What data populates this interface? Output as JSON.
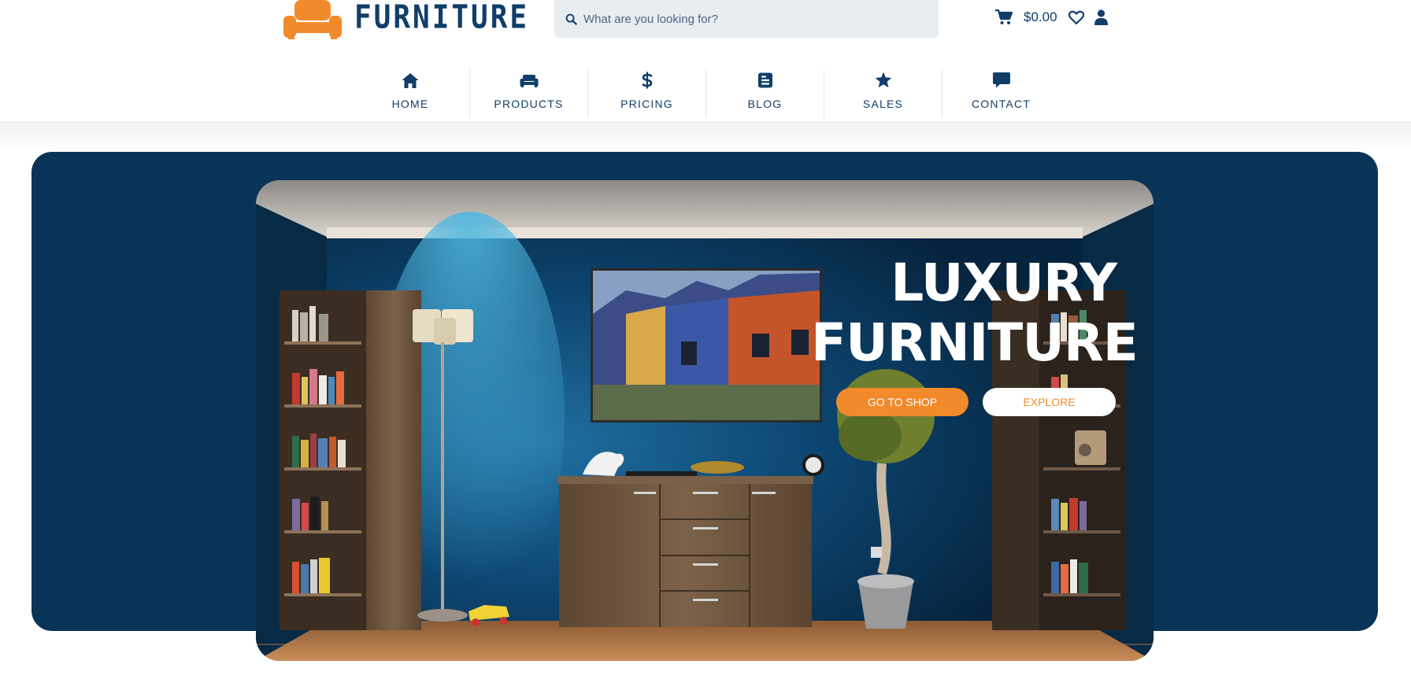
{
  "brand": {
    "name": "FURNITURE",
    "accent_color": "#f28a2b",
    "primary_color": "#103e69",
    "logo_icon": "sofa-icon"
  },
  "search": {
    "placeholder": "What are you looking for?",
    "value": "",
    "icon": "search-icon"
  },
  "header_actions": {
    "cart_icon": "cart-icon",
    "cart_total": "$0.00",
    "wishlist_icon": "heart-icon",
    "account_icon": "user-icon"
  },
  "nav": {
    "items": [
      {
        "label": "HOME",
        "icon": "home-icon"
      },
      {
        "label": "PRODUCTS",
        "icon": "sofa-icon"
      },
      {
        "label": "PRICING",
        "icon": "dollar-icon"
      },
      {
        "label": "BLOG",
        "icon": "blogger-icon"
      },
      {
        "label": "SALES",
        "icon": "star-icon"
      },
      {
        "label": "CONTACT",
        "icon": "comment-icon"
      }
    ]
  },
  "hero": {
    "title_line1": "LUXURY",
    "title_line2": "FURNITURE",
    "primary_button": "GO TO SHOP",
    "secondary_button": "EXPLORE",
    "background_color": "#0a3457"
  }
}
